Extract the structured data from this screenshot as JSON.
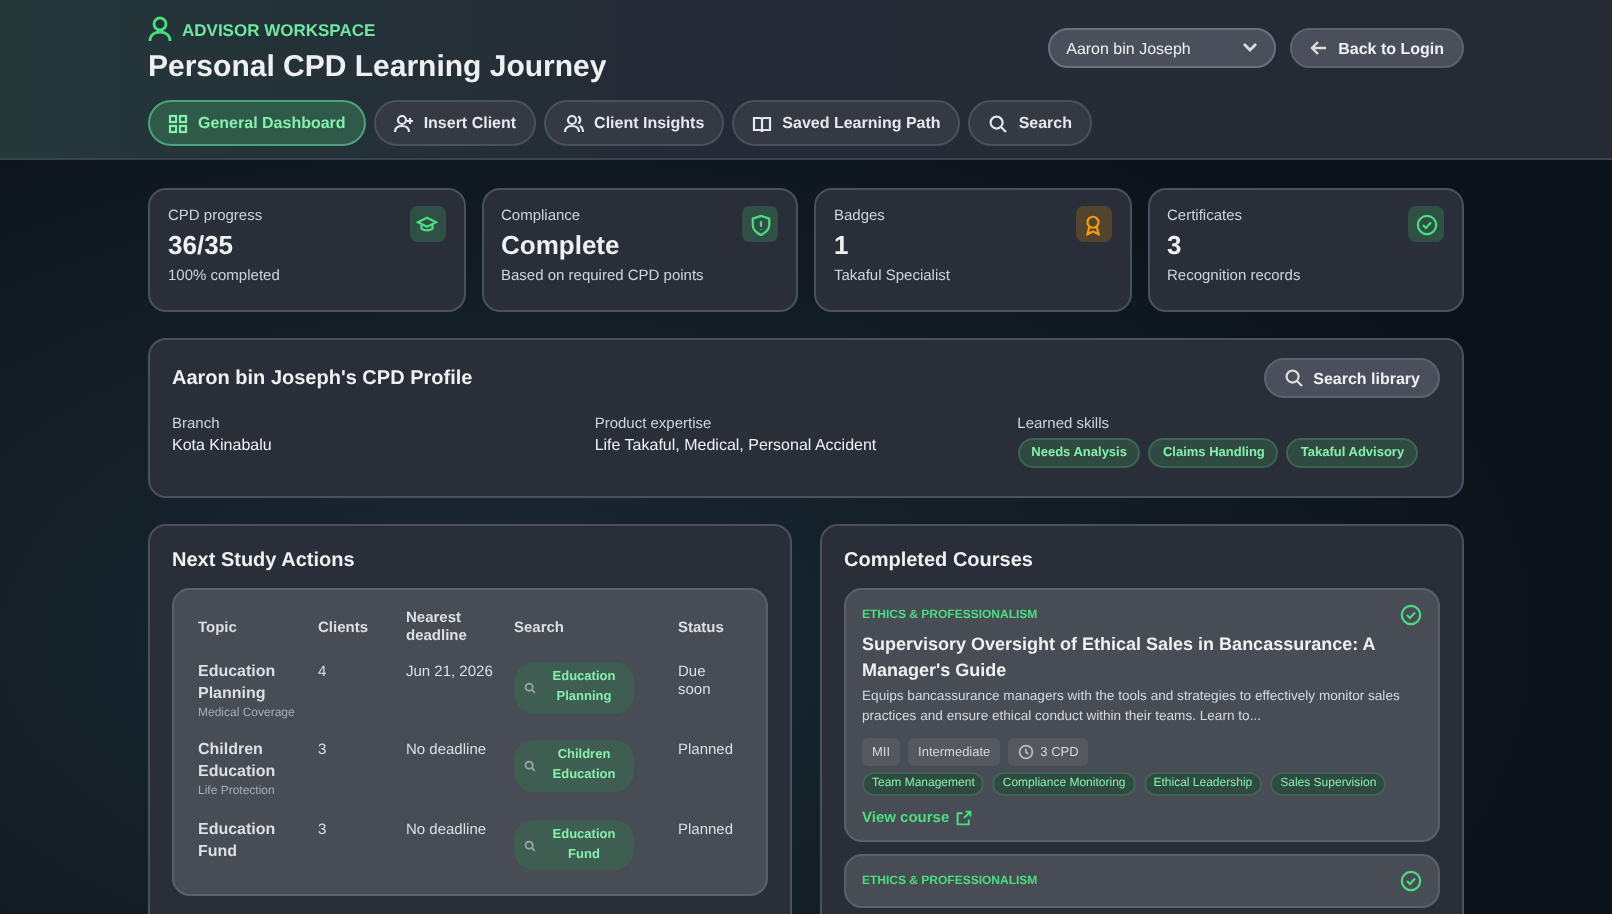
{
  "header": {
    "eyebrow": "ADVISOR WORKSPACE",
    "title": "Personal CPD Learning Journey",
    "advisor_select": {
      "value": "Aaron bin Joseph"
    },
    "back_button": "Back to Login"
  },
  "tabs": [
    {
      "label": "General Dashboard",
      "kind": "grid",
      "selected": true
    },
    {
      "label": "Insert Client",
      "kind": "user-plus",
      "selected": false
    },
    {
      "label": "Client Insights",
      "kind": "users",
      "selected": false
    },
    {
      "label": "Saved Learning Path",
      "kind": "book",
      "selected": false
    },
    {
      "label": "Search",
      "kind": "search",
      "selected": false
    }
  ],
  "stats": [
    {
      "label": "CPD progress",
      "value": "36/35",
      "note": "100% completed",
      "kind": "cap",
      "color": "#4ade80"
    },
    {
      "label": "Compliance",
      "value": "Complete",
      "note": "Based on required CPD points",
      "kind": "shield",
      "color": "#4ade80"
    },
    {
      "label": "Badges",
      "value": "1",
      "note": "Takaful Specialist",
      "kind": "award",
      "color": "#f59e0b"
    },
    {
      "label": "Certificates",
      "value": "3",
      "note": "Recognition records",
      "kind": "check",
      "color": "#4ade80"
    }
  ],
  "profile": {
    "title": "Aaron bin Joseph's CPD Profile",
    "search_button": "Search library",
    "fields": [
      {
        "label": "Branch",
        "value": "Kota Kinabalu"
      },
      {
        "label": "Product expertise",
        "value": "Life Takaful, Medical, Personal Accident"
      }
    ],
    "skills_label": "Learned skills",
    "skills": [
      "Needs Analysis",
      "Claims Handling",
      "Takaful Advisory"
    ]
  },
  "study": {
    "title": "Next Study Actions",
    "columns": [
      "Topic",
      "Clients",
      "Nearest deadline",
      "Search",
      "Status"
    ],
    "rows": [
      {
        "topic": "Education Planning",
        "sub": "Medical Coverage",
        "clients": "4",
        "deadline": "Jun 21, 2026",
        "search": "Education Planning",
        "status": "Due soon"
      },
      {
        "topic": "Children Education",
        "sub": "Life Protection",
        "clients": "3",
        "deadline": "No deadline",
        "search": "Children Education",
        "status": "Planned"
      },
      {
        "topic": "Education Fund",
        "clients": "3",
        "deadline": "No deadline",
        "search": "Education Fund",
        "status": "Planned"
      }
    ]
  },
  "completed": {
    "title": "Completed Courses",
    "courses": [
      {
        "category": "ETHICS & PROFESSIONALISM",
        "title": "Supervisory Oversight of Ethical Sales in Bancassurance: A Manager's Guide",
        "description": "Equips bancassurance managers with the tools and strategies to effectively monitor sales practices and ensure ethical conduct within their teams. Learn to...",
        "meta": [
          "MII",
          "Intermediate"
        ],
        "cpd": "3 CPD",
        "tags": [
          "Team Management",
          "Compliance Monitoring",
          "Ethical Leadership",
          "Sales Supervision"
        ],
        "link": "View course"
      },
      {
        "category": "ETHICS & PROFESSIONALISM"
      }
    ]
  }
}
